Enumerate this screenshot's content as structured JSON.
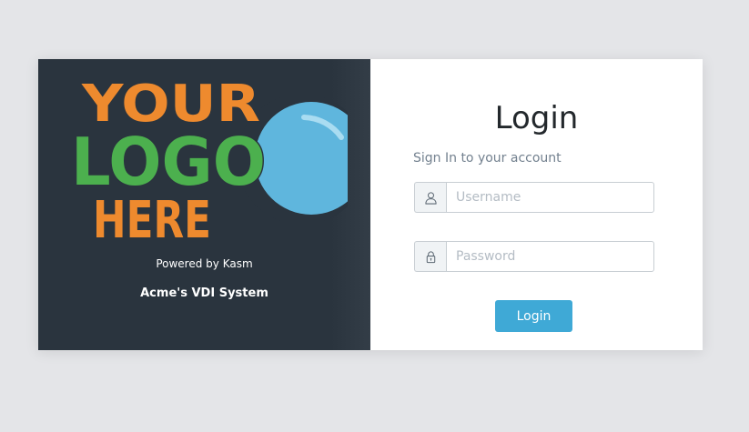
{
  "branding": {
    "logo_line1": "YOUR",
    "logo_line2": "LOGO",
    "logo_line3": "HERE",
    "powered_by": "Powered by Kasm",
    "system_name": "Acme's VDI System"
  },
  "login": {
    "title": "Login",
    "subtitle": "Sign In to your account",
    "username_placeholder": "Username",
    "password_placeholder": "Password",
    "button_label": "Login"
  },
  "colors": {
    "page_background": "#e4e5e8",
    "brand_panel": "#2a343e",
    "logo_orange": "#ee8a2e",
    "logo_green": "#4cb04e",
    "logo_blue": "#5fb6dd",
    "button": "#3fa9d6"
  },
  "icons": {
    "username": "user-icon",
    "password": "lock-icon"
  }
}
